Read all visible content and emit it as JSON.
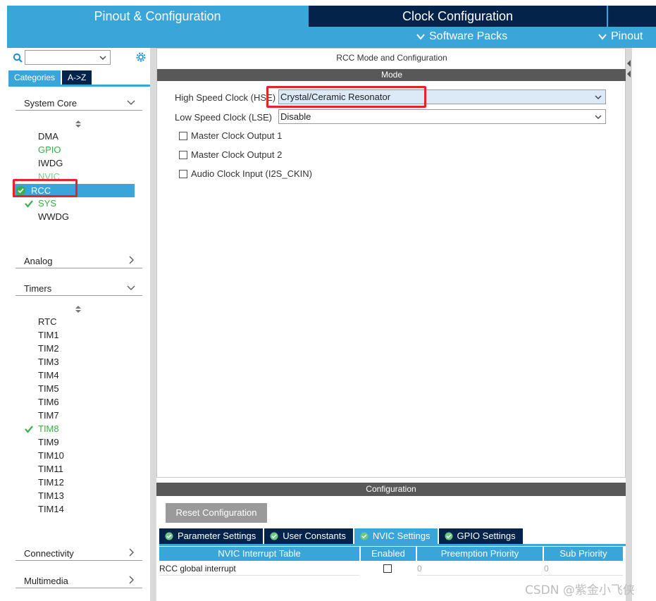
{
  "top_tabs": {
    "pinout": "Pinout & Configuration",
    "clock": "Clock Configuration"
  },
  "sub_nav": {
    "software_packs": "Software Packs",
    "pinout": "Pinout"
  },
  "sidebar": {
    "search_placeholder": "",
    "tab_categories": "Categories",
    "tab_az": "A->Z",
    "system_core": {
      "title": "System Core",
      "items": [
        "DMA",
        "GPIO",
        "IWDG",
        "NVIC",
        "RCC",
        "SYS",
        "WWDG"
      ]
    },
    "analog": {
      "title": "Analog"
    },
    "timers": {
      "title": "Timers",
      "items": [
        "RTC",
        "TIM1",
        "TIM2",
        "TIM3",
        "TIM4",
        "TIM5",
        "TIM6",
        "TIM7",
        "TIM8",
        "TIM9",
        "TIM10",
        "TIM11",
        "TIM12",
        "TIM13",
        "TIM14"
      ]
    },
    "connectivity": {
      "title": "Connectivity"
    },
    "multimedia": {
      "title": "Multimedia"
    }
  },
  "main": {
    "title": "RCC Mode and Configuration",
    "mode_header": "Mode",
    "hse_label": "High Speed Clock (HSE)",
    "hse_value": "Crystal/Ceramic Resonator",
    "lse_label": "Low Speed Clock (LSE)",
    "lse_value": "Disable",
    "checkboxes": [
      "Master Clock Output 1",
      "Master Clock Output 2",
      "Audio Clock Input (I2S_CKIN)"
    ]
  },
  "configuration": {
    "header": "Configuration",
    "reset_button": "Reset Configuration",
    "tabs": [
      "Parameter Settings",
      "User Constants",
      "NVIC Settings",
      "GPIO Settings"
    ],
    "active_tab": "NVIC Settings",
    "table": {
      "columns": [
        "NVIC Interrupt Table",
        "Enabled",
        "Preemption Priority",
        "Sub Priority"
      ],
      "rows": [
        {
          "name": "RCC global interrupt",
          "enabled": false,
          "preemption": "0",
          "sub": "0"
        }
      ]
    }
  },
  "watermark": "CSDN @紫金小飞侠",
  "colors": {
    "accent_blue": "#3aa5d8",
    "dark_navy": "#03234b",
    "green": "#3cae47",
    "highlight_red": "#e8222a"
  }
}
